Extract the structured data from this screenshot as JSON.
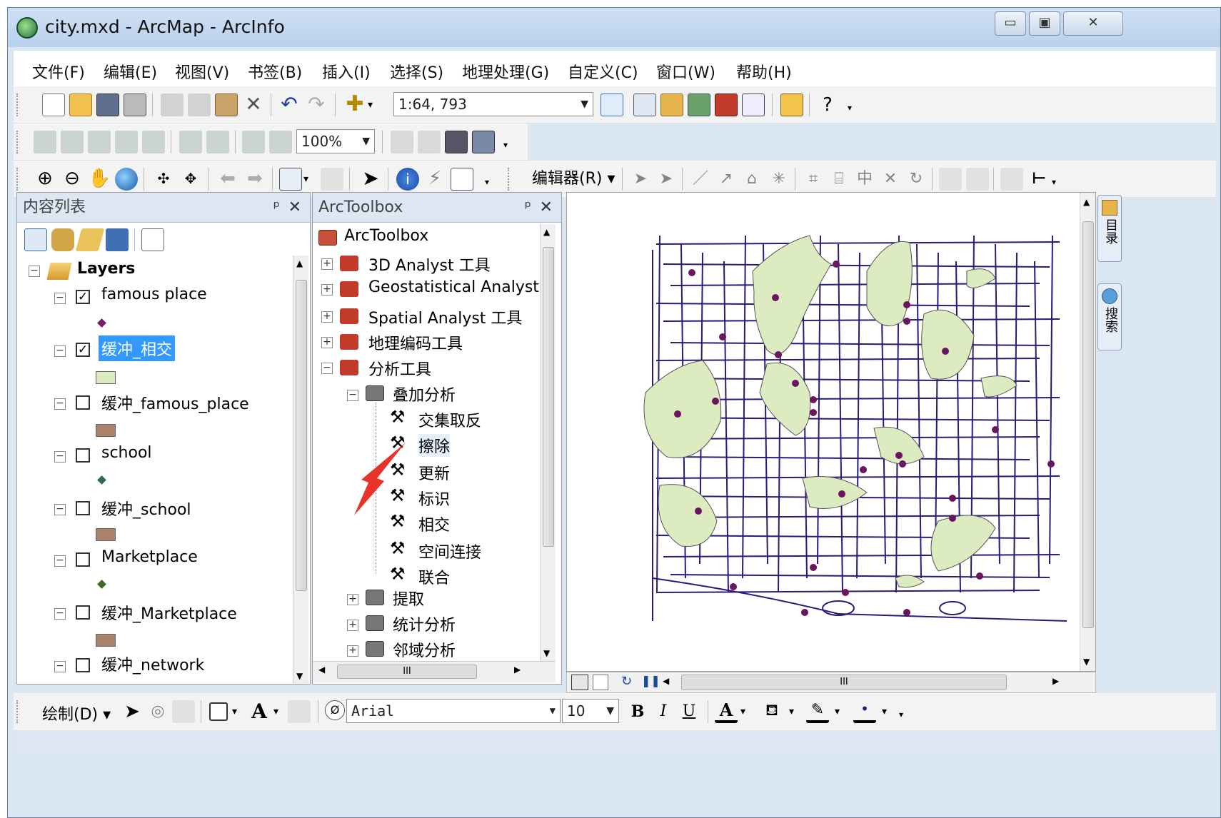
{
  "window": {
    "title": "city.mxd - ArcMap - ArcInfo",
    "minimize_glyph": "▭",
    "maximize_glyph": "▣",
    "close_glyph": "✕"
  },
  "menu": [
    "文件(F)",
    "编辑(E)",
    "视图(V)",
    "书签(B)",
    "插入(I)",
    "选择(S)",
    "地理处理(G)",
    "自定义(C)",
    "窗口(W)",
    "帮助(H)"
  ],
  "standard_toolbar": {
    "scale": "1:64, 793",
    "help_label": "?"
  },
  "layout_toolbar": {
    "zoom_percent": "100%"
  },
  "editor_toolbar": {
    "editor_label": "编辑器(R)",
    "dropdown_glyph": "▾"
  },
  "toc": {
    "title": "内容列表",
    "pin": "ᵖ",
    "close": "✕",
    "root": "Layers",
    "layers": [
      {
        "name": "famous place",
        "checked": true,
        "symbol_type": "point",
        "symbol_color": "#7a1a6a"
      },
      {
        "name": "缓冲_相交",
        "checked": true,
        "symbol_type": "polygon",
        "symbol_color": "#dcebc0",
        "selected": true
      },
      {
        "name": "缓冲_famous_place",
        "checked": false,
        "symbol_type": "polygon",
        "symbol_color": "#a8826a"
      },
      {
        "name": "school",
        "checked": false,
        "symbol_type": "point",
        "symbol_color": "#2f6b4f"
      },
      {
        "name": "缓冲_school",
        "checked": false,
        "symbol_type": "polygon",
        "symbol_color": "#a8826a"
      },
      {
        "name": "Marketplace",
        "checked": false,
        "symbol_type": "point",
        "symbol_color": "#3b6b2a"
      },
      {
        "name": "缓冲_Marketplace",
        "checked": false,
        "symbol_type": "polygon",
        "symbol_color": "#a8826a"
      },
      {
        "name": "缓冲_network",
        "checked": false,
        "symbol_type": "polygon",
        "symbol_color": "#a8826a"
      }
    ]
  },
  "toolbox": {
    "title": "ArcToolbox",
    "pin": "ᵖ",
    "close": "✕",
    "root": "ArcToolbox",
    "toolboxes": [
      "3D Analyst 工具",
      "Geostatistical Analyst",
      "Spatial Analyst 工具",
      "地理编码工具",
      "分析工具"
    ],
    "toolset_open": "叠加分析",
    "tools": [
      "交集取反",
      "擦除",
      "更新",
      "标识",
      "相交",
      "空间连接",
      "联合"
    ],
    "toolsets_closed": [
      "提取",
      "统计分析",
      "邻域分析"
    ],
    "hscroll_thumb": "III"
  },
  "map": {
    "road_color": "#2b1a7a",
    "buffer_color": "#dcebc0",
    "point_color": "#6a1560",
    "hscroll_thumb": "III"
  },
  "side_tabs": [
    "目录",
    "搜索"
  ],
  "draw_toolbar": {
    "draw_label": "绘制(D)",
    "font_name": "Arial",
    "font_size": "10",
    "bold": "B",
    "italic": "I",
    "underline": "U",
    "font_color_label": "A",
    "text_tool": "A"
  }
}
